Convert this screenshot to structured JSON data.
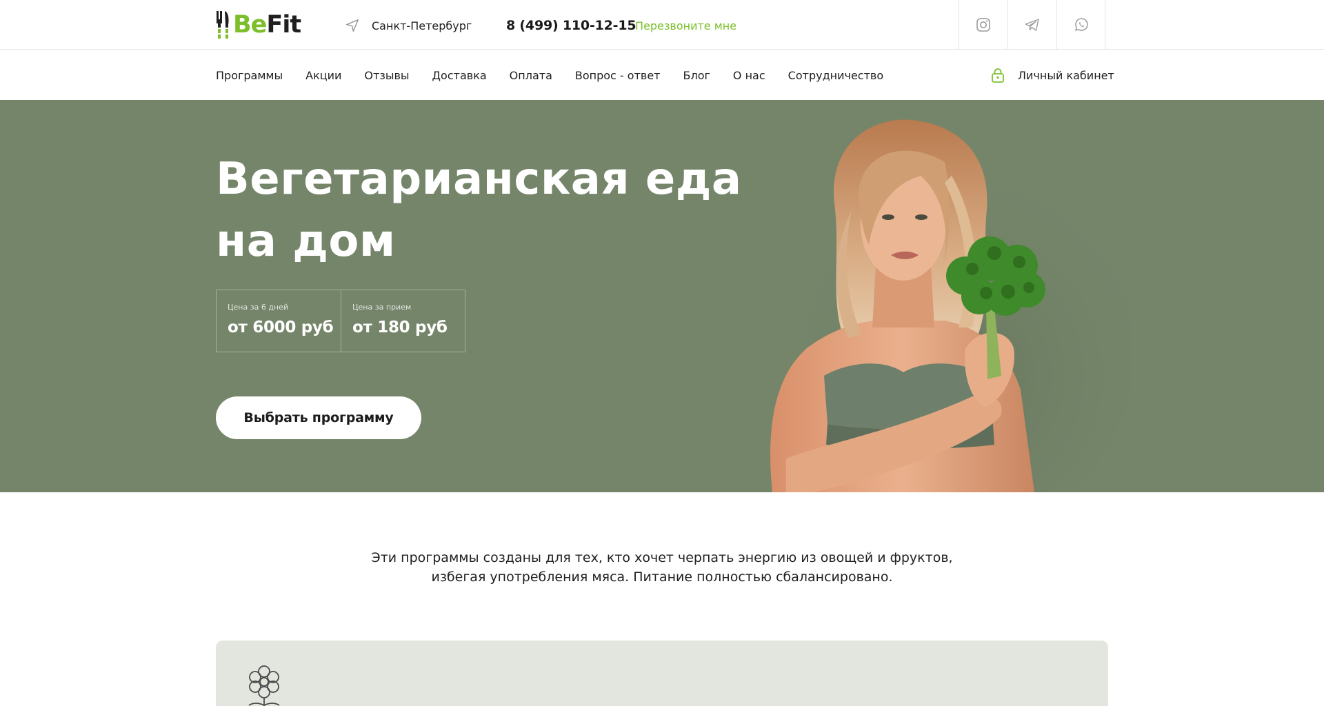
{
  "brand": {
    "part1": "Be",
    "part2": "Fit",
    "accent_color": "#7cbf2b"
  },
  "header": {
    "city_icon": "location-arrow-icon",
    "city": "Санкт-Петербург",
    "phone": "8 (499) 110-12-15",
    "callback_label": "Перезвоните мне",
    "socials": [
      "instagram-icon",
      "telegram-icon",
      "whatsapp-icon"
    ]
  },
  "nav": {
    "items": [
      "Программы",
      "Акции",
      "Отзывы",
      "Доставка",
      "Оплата",
      "Вопрос - ответ",
      "Блог",
      "О нас",
      "Сотрудничество"
    ],
    "account_icon": "lock-icon",
    "account_label": "Личный кабинет"
  },
  "hero": {
    "background_color": "#75856a",
    "title_line1": "Вегетарианская еда",
    "title_line2": "на дом",
    "prices": [
      {
        "label": "Цена за 6 дней",
        "value": "от 6000 руб"
      },
      {
        "label": "Цена за прием",
        "value": "от 180 руб"
      }
    ],
    "cta_label": "Выбрать программу"
  },
  "intro": {
    "line1": "Эти программы созданы для тех, кто хочет черпать энергию из овощей и фруктов,",
    "line2": "избегая употребления мяса. Питание полностью сбалансировано."
  },
  "card": {
    "icon": "flower-icon",
    "background_color": "#e3e6df"
  }
}
